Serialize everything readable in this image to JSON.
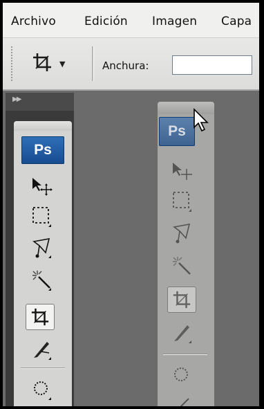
{
  "menubar": {
    "items": [
      "Archivo",
      "Edición",
      "Imagen",
      "Capa"
    ]
  },
  "options_bar": {
    "crop_icon": "crop-icon",
    "dropdown_icon": "caret-down-icon",
    "width_label": "Anchura:",
    "width_value": ""
  },
  "toolbox": {
    "logo": "Ps",
    "tools": [
      "move-tool-icon",
      "rectangular-marquee-icon",
      "lasso-icon",
      "magic-wand-icon",
      "crop-icon",
      "slice-icon",
      "healing-brush-icon"
    ],
    "active_tool": "crop-icon"
  },
  "floating_toolbox": {
    "logo": "Ps"
  },
  "colors": {
    "canvas_bg": "#6b6b6b",
    "ps_blue": "#1f5aa0"
  }
}
